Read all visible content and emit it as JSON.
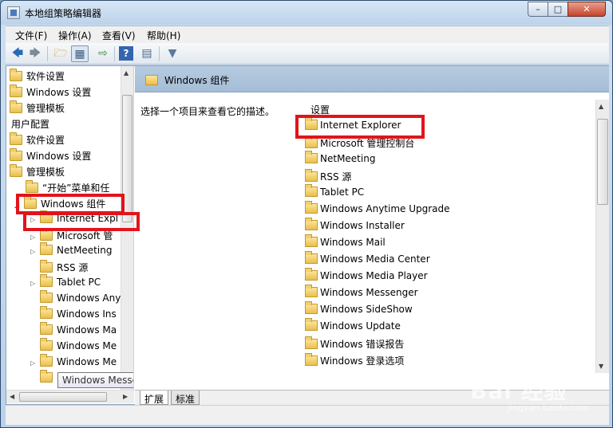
{
  "window": {
    "title": "本地组策略编辑器"
  },
  "menu": [
    {
      "label": "文件(F)"
    },
    {
      "label": "操作(A)"
    },
    {
      "label": "查看(V)"
    },
    {
      "label": "帮助(H)"
    }
  ],
  "toolbar": {
    "icons": [
      "back-arrow-icon",
      "forward-arrow-icon",
      "up-folder-icon",
      "show-tree-icon",
      "export-list-icon",
      "help-icon",
      "properties-icon",
      "filter-icon"
    ]
  },
  "tree": {
    "items": [
      {
        "label": "软件设置",
        "folder": true
      },
      {
        "label": "Windows 设置",
        "folder": true
      },
      {
        "label": "管理模板",
        "folder": true
      },
      {
        "label": "用户配置",
        "folder": false
      },
      {
        "label": "软件设置",
        "folder": true
      },
      {
        "label": "Windows 设置",
        "folder": true
      },
      {
        "label": "管理模板",
        "folder": true
      },
      {
        "label": "“开始”菜单和任",
        "folder": true
      },
      {
        "label": "Windows 组件",
        "folder": true
      },
      {
        "label": "Internet Expl",
        "folder": true
      },
      {
        "label": "Microsoft 管",
        "folder": true
      },
      {
        "label": "NetMeeting",
        "folder": true
      },
      {
        "label": "RSS 源",
        "folder": true
      },
      {
        "label": "Tablet PC",
        "folder": true
      },
      {
        "label": "Windows Any",
        "folder": true
      },
      {
        "label": "Windows Ins",
        "folder": true
      },
      {
        "label": "Windows Ma",
        "folder": true
      },
      {
        "label": "Windows Me",
        "folder": true
      },
      {
        "label": "Windows Me",
        "folder": true
      },
      {
        "label": "Windows Messenger",
        "folder": true
      }
    ],
    "tooltip": "Windows Messenger"
  },
  "right": {
    "header_title": "Windows 组件",
    "description": "选择一个项目来查看它的描述。",
    "column_header": "设置",
    "items": [
      "Internet Explorer",
      "Microsoft 管理控制台",
      "NetMeeting",
      "RSS 源",
      "Tablet PC",
      "Windows Anytime Upgrade",
      "Windows Installer",
      "Windows Mail",
      "Windows Media Center",
      "Windows Media Player",
      "Windows Messenger",
      "Windows SideShow",
      "Windows Update",
      "Windows 错误报告",
      "Windows 登录选项"
    ]
  },
  "tabs": [
    {
      "label": "扩展"
    },
    {
      "label": "标准"
    }
  ],
  "watermark": {
    "text": "Bai 经验",
    "sub": "jingyan.baidu.com"
  },
  "colors": {
    "highlight": "#e2141b",
    "header": "#b6cbe0"
  }
}
